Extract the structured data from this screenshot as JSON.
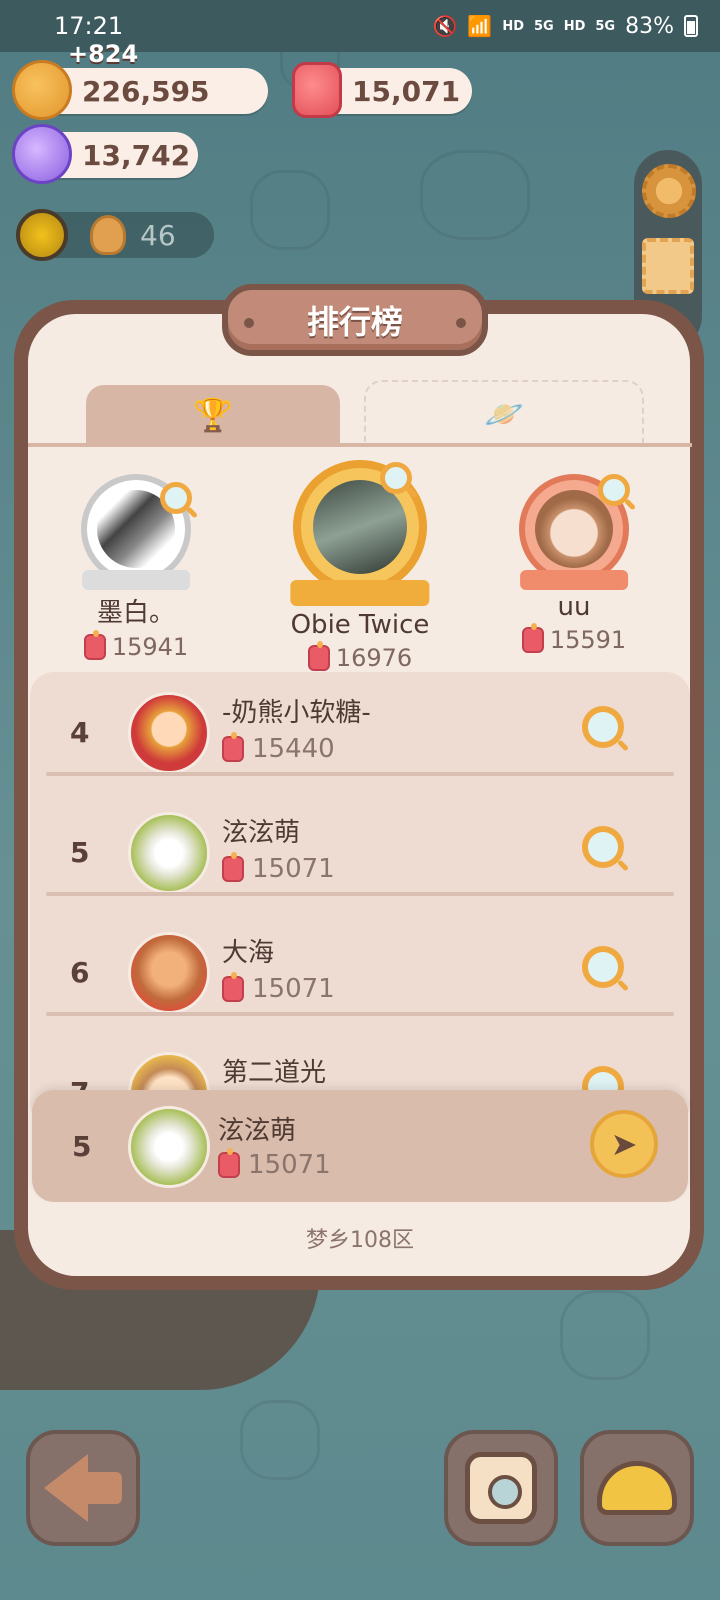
{
  "status_bar": {
    "time": "17:21",
    "battery": "83%",
    "icons": [
      "mute-icon",
      "wifi-icon",
      "hd-icon",
      "signal-5g-icon",
      "hd-icon",
      "signal-5g-icon",
      "battery-icon"
    ],
    "hd1": "HD",
    "g1": "5G",
    "hd2": "HD",
    "g2": "5G"
  },
  "currencies": {
    "cookies": "226,595",
    "cookies_gain": "+824",
    "candles": "15,071",
    "candy": "13,742",
    "sun_count": "46"
  },
  "leaderboard": {
    "title": "排行榜",
    "tabs": [
      {
        "icon": "trophy-icon",
        "active": false
      },
      {
        "icon": "planet-icon",
        "active": true
      }
    ],
    "podium": [
      {
        "rank": 2,
        "name": "墨白。",
        "score": "15941"
      },
      {
        "rank": 1,
        "name": "Obie Twice",
        "score": "16976"
      },
      {
        "rank": 3,
        "name": "uu",
        "score": "15591"
      }
    ],
    "rows": [
      {
        "rank": "4",
        "name": "-奶熊小软糖-",
        "score": "15440"
      },
      {
        "rank": "5",
        "name": "泫泫萌",
        "score": "15071"
      },
      {
        "rank": "6",
        "name": "大海",
        "score": "15071"
      },
      {
        "rank": "7",
        "name": "第二道光",
        "score": ""
      }
    ],
    "my_row": {
      "rank": "5",
      "name": "泫泫萌",
      "score": "15071"
    },
    "server": "梦乡108区"
  },
  "colors": {
    "panel_border": "#7a5548",
    "panel_bg": "#f6ebe2",
    "accent_gold": "#f3c257"
  }
}
